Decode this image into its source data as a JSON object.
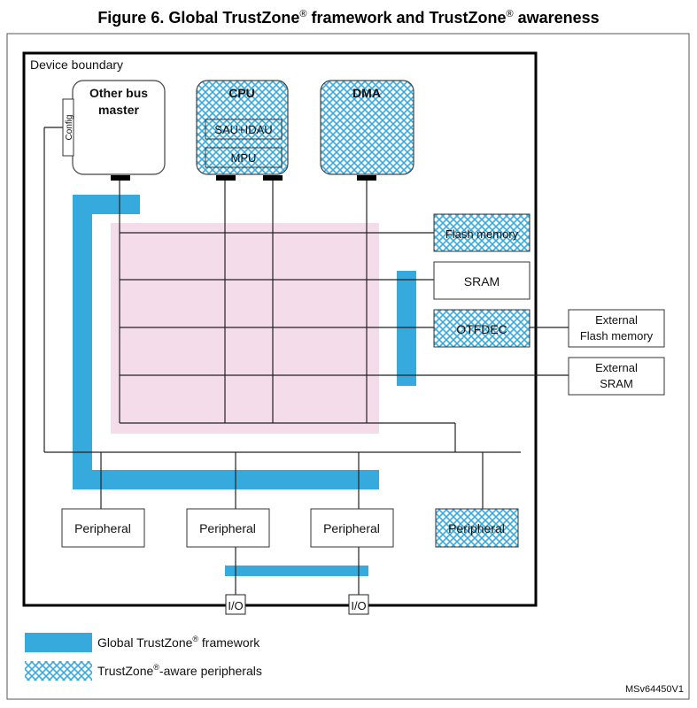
{
  "figure": {
    "title_parts": [
      "Figure 6. Global TrustZone",
      "®",
      " framework and TrustZone",
      "®",
      " awareness"
    ],
    "device_boundary_label": "Device boundary",
    "reference_id": "MSv64450V1"
  },
  "colors": {
    "trustzone_framework": "#36aadc",
    "trustzone_aware_hatch": "#36aadc",
    "interconnect_matrix": "#f5dceb",
    "line": "#111111"
  },
  "masters": {
    "other_bus_master": {
      "label_line1": "Other bus",
      "label_line2": "master",
      "config_label": "Config"
    },
    "cpu": {
      "label": "CPU",
      "sub_blocks": [
        "SAU+IDAU",
        "MPU"
      ]
    },
    "dma": {
      "label": "DMA"
    }
  },
  "memories": {
    "flash": "Flash memory",
    "sram": "SRAM",
    "otfdec": "OTFDEC",
    "ext_flash_line1": "External",
    "ext_flash_line2": "Flash memory",
    "ext_sram_line1": "External",
    "ext_sram_line2": "SRAM"
  },
  "peripherals": [
    "Peripheral",
    "Peripheral",
    "Peripheral",
    "Peripheral"
  ],
  "io_labels": [
    "I/O",
    "I/O"
  ],
  "legend": {
    "framework": {
      "text": "Global TrustZone",
      "sup": "®",
      "suffix": " framework"
    },
    "aware": {
      "text": "TrustZone",
      "sup": "®",
      "suffix": "-aware peripherals"
    }
  }
}
